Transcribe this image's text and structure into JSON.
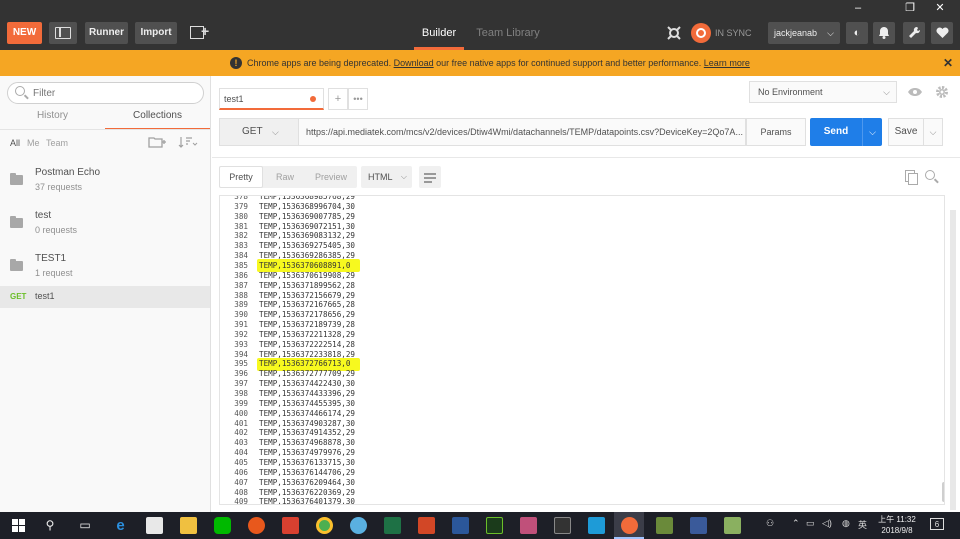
{
  "header": {
    "new_label": "NEW",
    "runner_label": "Runner",
    "import_label": "Import",
    "tabs": [
      {
        "label": "Builder",
        "active": true
      },
      {
        "label": "Team Library",
        "active": false
      }
    ],
    "sync_label": "IN SYNC",
    "username": "jackjeanab",
    "window_controls": [
      "–",
      "❐",
      "✕"
    ]
  },
  "banner": {
    "text_before": "Chrome apps are being deprecated. ",
    "link_download": "Download",
    "text_middle": " our free native apps for continued support and better performance. ",
    "link_learn": "Learn more",
    "close": "✕"
  },
  "sidebar": {
    "filter_placeholder": "Filter",
    "tabs": [
      {
        "label": "History",
        "active": false
      },
      {
        "label": "Collections",
        "active": true
      }
    ],
    "sub_filters": [
      {
        "label": "All",
        "active": true
      },
      {
        "label": "Me",
        "active": false
      },
      {
        "label": "Team",
        "active": false
      }
    ],
    "collections": [
      {
        "name": "Postman Echo",
        "count": "37 requests"
      },
      {
        "name": "test",
        "count": "0 requests"
      },
      {
        "name": "TEST1",
        "count": "1 request"
      }
    ],
    "request_item": {
      "method": "GET",
      "name": "test1"
    }
  },
  "request": {
    "tab_label": "test1",
    "environment": "No Environment",
    "method": "GET",
    "url": "https://api.mediatek.com/mcs/v2/devices/Dtiw4Wmi/datachannels/TEMP/datapoints.csv?DeviceKey=2Qo7A...",
    "params_label": "Params",
    "send_label": "Send",
    "save_label": "Save"
  },
  "response": {
    "tabs": [
      {
        "label": "Pretty",
        "active": true
      },
      {
        "label": "Raw",
        "active": false
      },
      {
        "label": "Preview",
        "active": false
      }
    ],
    "format": "HTML",
    "lines": [
      {
        "n": "378",
        "text": "TEMP,1536368985768,29",
        "highlight": false
      },
      {
        "n": "379",
        "text": "TEMP,1536368996704,30",
        "highlight": false
      },
      {
        "n": "380",
        "text": "TEMP,1536369007785,29",
        "highlight": false
      },
      {
        "n": "381",
        "text": "TEMP,1536369072151,30",
        "highlight": false
      },
      {
        "n": "382",
        "text": "TEMP,1536369083132,29",
        "highlight": false
      },
      {
        "n": "383",
        "text": "TEMP,1536369275405,30",
        "highlight": false
      },
      {
        "n": "384",
        "text": "TEMP,1536369286385,29",
        "highlight": false
      },
      {
        "n": "385",
        "text": "TEMP,1536370608891,0",
        "highlight": true
      },
      {
        "n": "386",
        "text": "TEMP,1536370619908,29",
        "highlight": false
      },
      {
        "n": "387",
        "text": "TEMP,1536371899562,28",
        "highlight": false
      },
      {
        "n": "388",
        "text": "TEMP,1536372156679,29",
        "highlight": false
      },
      {
        "n": "389",
        "text": "TEMP,1536372167665,28",
        "highlight": false
      },
      {
        "n": "390",
        "text": "TEMP,1536372178656,29",
        "highlight": false
      },
      {
        "n": "391",
        "text": "TEMP,1536372189739,28",
        "highlight": false
      },
      {
        "n": "392",
        "text": "TEMP,1536372211328,29",
        "highlight": false
      },
      {
        "n": "393",
        "text": "TEMP,1536372222514,28",
        "highlight": false
      },
      {
        "n": "394",
        "text": "TEMP,1536372233818,29",
        "highlight": false
      },
      {
        "n": "395",
        "text": "TEMP,1536372766713,0",
        "highlight": true
      },
      {
        "n": "396",
        "text": "TEMP,1536372777709,29",
        "highlight": false
      },
      {
        "n": "397",
        "text": "TEMP,1536374422430,30",
        "highlight": false
      },
      {
        "n": "398",
        "text": "TEMP,1536374433396,29",
        "highlight": false
      },
      {
        "n": "399",
        "text": "TEMP,1536374455395,30",
        "highlight": false
      },
      {
        "n": "400",
        "text": "TEMP,1536374466174,29",
        "highlight": false
      },
      {
        "n": "401",
        "text": "TEMP,1536374903287,30",
        "highlight": false
      },
      {
        "n": "402",
        "text": "TEMP,1536374914352,29",
        "highlight": false
      },
      {
        "n": "403",
        "text": "TEMP,1536374968878,30",
        "highlight": false
      },
      {
        "n": "404",
        "text": "TEMP,1536374979976,29",
        "highlight": false
      },
      {
        "n": "405",
        "text": "TEMP,1536376133715,30",
        "highlight": false
      },
      {
        "n": "406",
        "text": "TEMP,1536376144706,29",
        "highlight": false
      },
      {
        "n": "407",
        "text": "TEMP,1536376209464,30",
        "highlight": false
      },
      {
        "n": "408",
        "text": "TEMP,1536376220369,29",
        "highlight": false
      },
      {
        "n": "409",
        "text": "TEMP,1536376401379,30",
        "highlight": false
      }
    ]
  },
  "taskbar": {
    "time": "上午 11:32",
    "date": "2018/9/8",
    "ime": "英",
    "notification_count": "6"
  }
}
